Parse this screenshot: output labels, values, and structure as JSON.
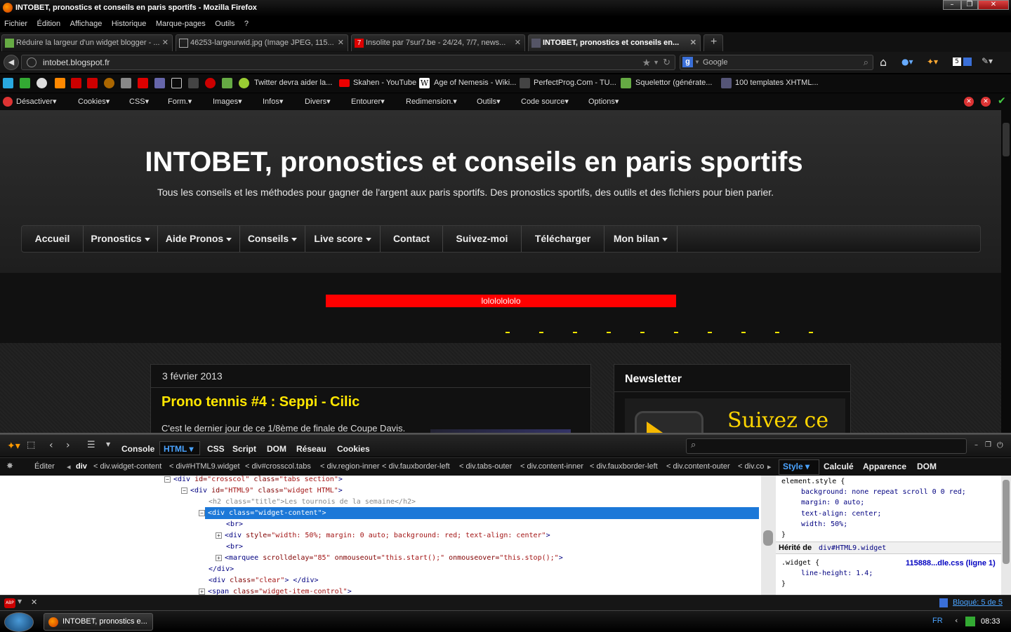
{
  "window": {
    "title": "INTOBET, pronostics et conseils en paris sportifs - Mozilla Firefox"
  },
  "menu": [
    "Fichier",
    "Édition",
    "Affichage",
    "Historique",
    "Marque-pages",
    "Outils",
    "?"
  ],
  "tabs": [
    {
      "label": "Réduire la largeur d'un widget blogger - ...",
      "close": "✕"
    },
    {
      "label": "46253-largeurwid.jpg (Image JPEG, 115...",
      "close": "✕"
    },
    {
      "label": "Insolite par 7sur7.be - 24/24, 7/7, news...",
      "close": "✕"
    },
    {
      "label": "INTOBET, pronostics et conseils en...",
      "close": "✕"
    }
  ],
  "new_tab": "+",
  "navbar": {
    "url": "intobet.blogspot.fr",
    "search_engine": "Google"
  },
  "bookmarks": [
    "Twitter devra aider la...",
    "Skahen - YouTube",
    "Age of Nemesis - Wiki...",
    "PerfectProg.Com - TU...",
    "Squelettor (générate...",
    "100 templates XHTML..."
  ],
  "devtoolbar": [
    "Désactiver",
    "Cookies",
    "CSS",
    "Form.",
    "Images",
    "Infos",
    "Divers",
    "Entourer",
    "Redimension.",
    "Outils",
    "Code source",
    "Options"
  ],
  "blog": {
    "title": "INTOBET, pronostics et conseils en paris sportifs",
    "description": "Tous les conseils et les méthodes pour gagner de l'argent aux paris sportifs. Des pronostics sportifs, des outils et des fichiers pour bien parier.",
    "nav": [
      {
        "label": "Accueil",
        "caret": false
      },
      {
        "label": "Pronostics",
        "caret": true
      },
      {
        "label": "Aide Pronos",
        "caret": true
      },
      {
        "label": "Conseils",
        "caret": true
      },
      {
        "label": "Live score",
        "caret": true
      },
      {
        "label": "Contact",
        "caret": false
      },
      {
        "label": "Suivez-moi",
        "caret": false
      },
      {
        "label": "Télécharger",
        "caret": false
      },
      {
        "label": "Mon bilan",
        "caret": true
      }
    ],
    "red_widget_text": "lolololololo",
    "post": {
      "date": "3 février 2013",
      "title": "Prono tennis #4 : Seppi - Cilic",
      "excerpt": "C'est le dernier jour de ce 1/8ème de finale de Coupe Davis."
    },
    "sidebar": {
      "title": "Newsletter",
      "image_text": "Suivez ce"
    }
  },
  "firebug": {
    "tabs": [
      "Console",
      "HTML",
      "CSS",
      "Script",
      "DOM",
      "Réseau",
      "Cookies"
    ],
    "edit_label": "Éditer",
    "breadcrumb": [
      "div",
      "div.widget-content",
      "div#HTML9.widget",
      "div#crosscol.tabs",
      "div.region-inner",
      "div.fauxborder-left",
      "div.tabs-outer",
      "div.content-inner",
      "div.fauxborder-left",
      "div.content-outer",
      "div.co"
    ],
    "side_tabs": [
      "Style",
      "Calculé",
      "Apparence",
      "DOM"
    ],
    "style": {
      "selector1": "element.style {",
      "rules": [
        "background: none repeat scroll 0 0 red;",
        "margin: 0 auto;",
        "text-align: center;",
        "width: 50%;"
      ],
      "close1": "}",
      "inherited_label": "Hérité de",
      "inherited_from": "div#HTML9.widget",
      "selector2": ".widget {",
      "source": "115888...dle.css (ligne 1)",
      "rule2": "line-height: 1.4;",
      "close2": "}"
    }
  },
  "statusbar": {
    "blocked": "Bloqué: 5 de 5"
  },
  "taskbar": {
    "window_label": "INTOBET, pronostics e...",
    "lang": "FR",
    "time": "08:33"
  }
}
